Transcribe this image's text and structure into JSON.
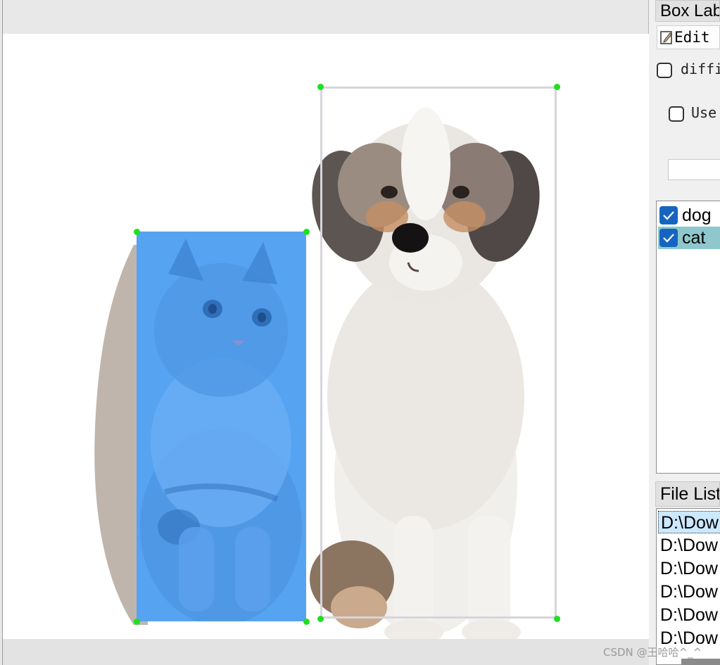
{
  "dock": {
    "title": "Box Labels",
    "edit_label": "Edit Label",
    "difficult_label": "difficult",
    "use_default_label": "Use default label"
  },
  "labels": [
    {
      "name": "dog",
      "checked": true
    },
    {
      "name": "cat",
      "checked": true
    }
  ],
  "file_list": {
    "title": "File List",
    "items": [
      "D:\\Dow",
      "D:\\Dow",
      "D:\\Dow",
      "D:\\Dow",
      "D:\\Dow",
      "D:\\Dow"
    ]
  },
  "watermark": "CSDN @王哈哈^_^",
  "colors": {
    "cat_box_fill": "#56a3f2",
    "dog_box_outline": "#d5d5dc",
    "vertex": "#1fe01f",
    "label_check": "#1565c0",
    "selected_label_bg": "#8fc8cc"
  }
}
